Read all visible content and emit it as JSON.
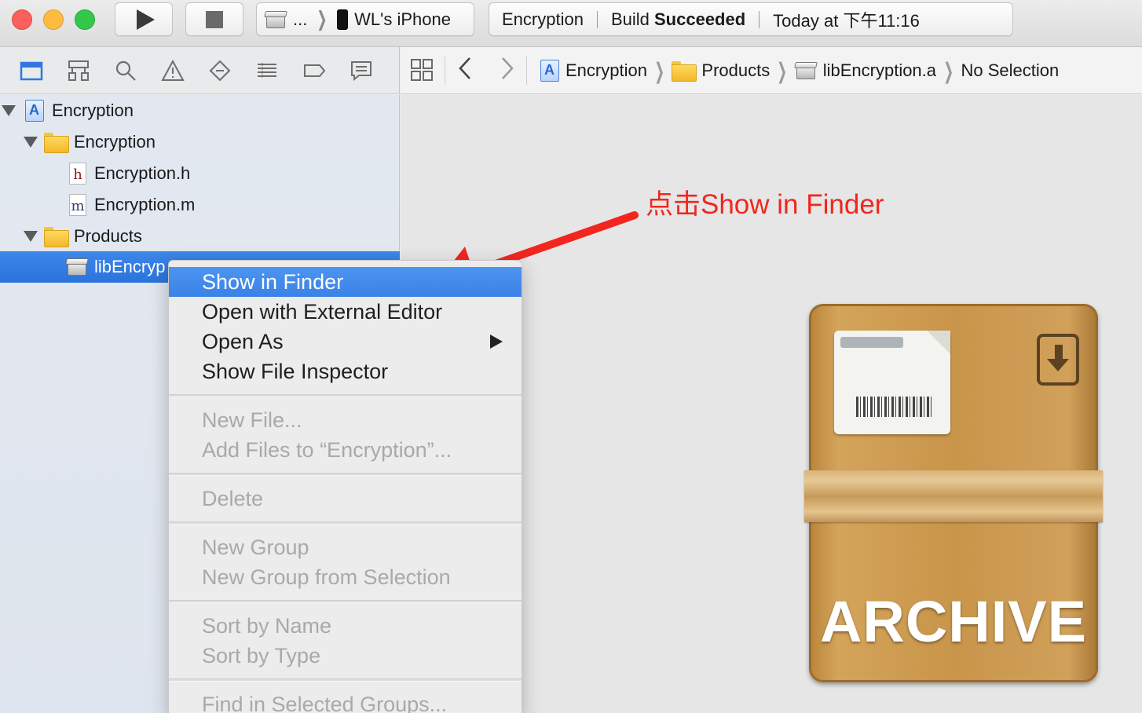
{
  "toolbar": {
    "scheme_target": "...",
    "device": "WL's iPhone",
    "activity": {
      "project": "Encryption",
      "status_prefix": "Build",
      "status_bold": "Succeeded",
      "time": "Today at 下午11:16"
    }
  },
  "navigator": {
    "icons": [
      "folder-icon",
      "hierarchy-icon",
      "search-icon",
      "warning-icon",
      "test-icon",
      "debug-icon",
      "breakpoint-icon",
      "report-icon"
    ],
    "tree": [
      {
        "label": "Encryption",
        "kind": "project",
        "level": 0
      },
      {
        "label": "Encryption",
        "kind": "folder",
        "level": 1
      },
      {
        "label": "Encryption.h",
        "kind": "header",
        "level": 2,
        "glyph": "h"
      },
      {
        "label": "Encryption.m",
        "kind": "source",
        "level": 2,
        "glyph": "m"
      },
      {
        "label": "Products",
        "kind": "folder",
        "level": 1
      },
      {
        "label": "libEncryp",
        "kind": "library",
        "level": 2,
        "selected": true
      }
    ]
  },
  "jumpbar": {
    "crumbs": [
      "Encryption",
      "Products",
      "libEncryption.a",
      "No Selection"
    ]
  },
  "context_menu": {
    "groups": [
      [
        {
          "label": "Show in Finder",
          "highlighted": true
        },
        {
          "label": "Open with External Editor"
        },
        {
          "label": "Open As",
          "submenu": true
        },
        {
          "label": "Show File Inspector"
        }
      ],
      [
        {
          "label": "New File...",
          "disabled": true
        },
        {
          "label": "Add Files to “Encryption”...",
          "disabled": true
        }
      ],
      [
        {
          "label": "Delete",
          "disabled": true
        }
      ],
      [
        {
          "label": "New Group",
          "disabled": true
        },
        {
          "label": "New Group from Selection",
          "disabled": true
        }
      ],
      [
        {
          "label": "Sort by Name",
          "disabled": true
        },
        {
          "label": "Sort by Type",
          "disabled": true
        }
      ],
      [
        {
          "label": "Find in Selected Groups...",
          "disabled": true
        }
      ]
    ]
  },
  "annotation": {
    "text": "点击Show in Finder",
    "color": "#f2261e"
  },
  "preview": {
    "archive_word": "ARCHIVE"
  },
  "colors": {
    "selection": "#2f78e0",
    "menu_highlight": "#3a82e6"
  }
}
